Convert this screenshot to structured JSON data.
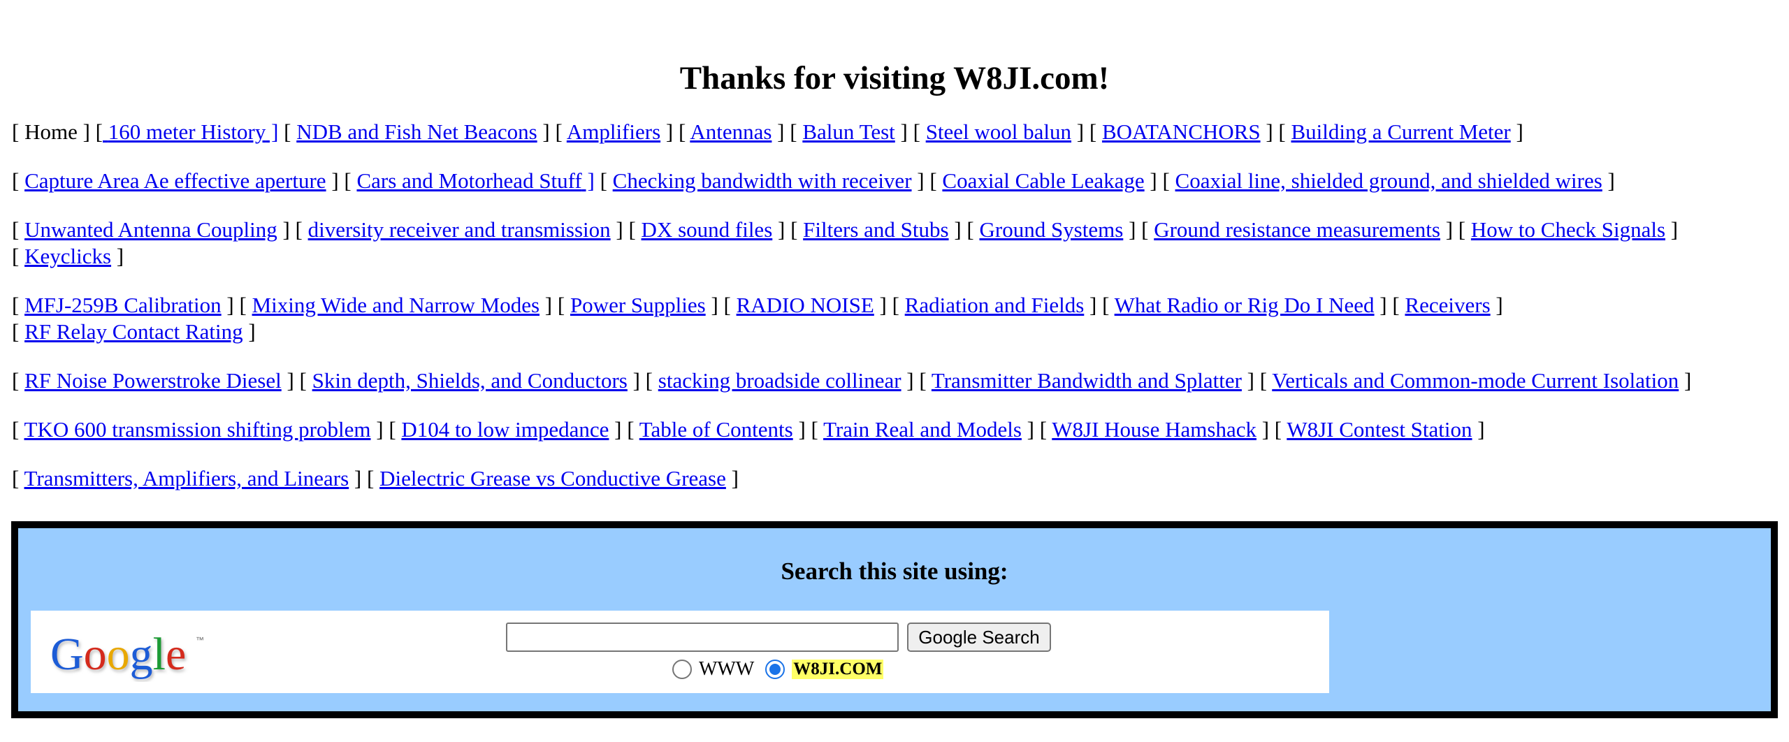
{
  "title": "Thanks for visiting W8JI.com!",
  "nav": {
    "home_label": "Home",
    "rows": [
      [
        "160 meter History",
        "NDB and Fish Net Beacons",
        "Amplifiers",
        "Antennas",
        "Balun Test",
        "Steel wool balun",
        "BOATANCHORS",
        "Building a Current Meter"
      ],
      [
        "Capture Area Ae effective aperture",
        "Cars and Motorhead Stuff",
        "Checking bandwidth with receiver",
        "Coaxial Cable Leakage",
        "Coaxial line, shielded ground, and shielded wires"
      ],
      [
        "Unwanted Antenna Coupling",
        "diversity receiver and transmission",
        "DX sound files",
        "Filters and Stubs",
        "Ground Systems",
        "Ground resistance measurements",
        "How to Check Signals",
        "Keyclicks"
      ],
      [
        "MFJ-259B Calibration",
        "Mixing Wide and Narrow Modes",
        "Power Supplies",
        "RADIO NOISE",
        "Radiation and Fields",
        "What Radio or Rig Do I Need",
        "Receivers",
        "RF Relay Contact Rating"
      ],
      [
        "RF Noise Powerstroke Diesel",
        "Skin depth, Shields, and Conductors",
        "stacking broadside collinear",
        "Transmitter Bandwidth and Splatter",
        "Verticals and Common-mode Current Isolation"
      ],
      [
        "TKO 600 transmission shifting problem",
        "D104 to low impedance",
        "Table of Contents",
        "Train Real and Models",
        "W8JI House Hamshack",
        "W8JI Contest Station"
      ],
      [
        "Transmitters, Amplifiers, and Linears",
        "Dielectric Grease vs Conductive Grease"
      ]
    ]
  },
  "search": {
    "heading": "Search this site using:",
    "logo_text": "Google",
    "logo_tm": "™",
    "input_value": "",
    "button_label": "Google Search",
    "radio_www_label": "WWW",
    "radio_site_label": "W8JI.COM",
    "selected": "W8JI.COM"
  },
  "colors": {
    "link": "#0000ee",
    "search_background": "#99ccff",
    "site_highlight": "#ffff66",
    "radio_selected": "#1a73e8"
  }
}
